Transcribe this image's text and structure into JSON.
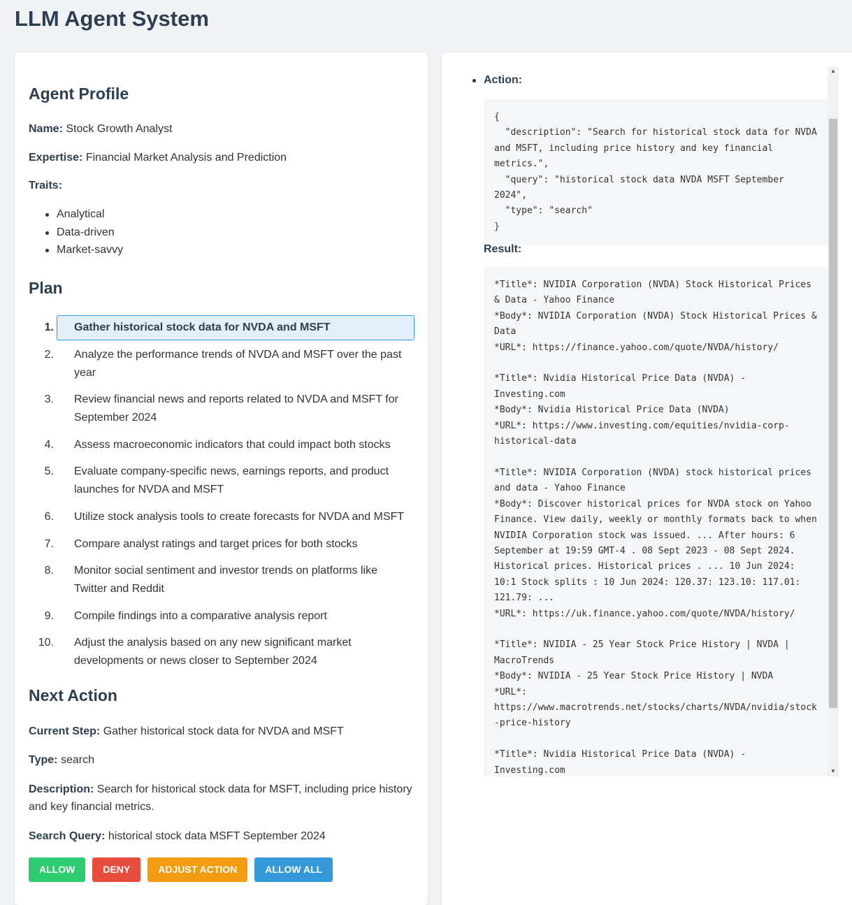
{
  "app": {
    "title": "LLM Agent System"
  },
  "profile": {
    "heading": "Agent Profile",
    "name_label": "Name:",
    "name": "Stock Growth Analyst",
    "expertise_label": "Expertise:",
    "expertise": "Financial Market Analysis and Prediction",
    "traits_label": "Traits:",
    "traits": [
      "Analytical",
      "Data-driven",
      "Market-savvy"
    ]
  },
  "plan": {
    "heading": "Plan",
    "active_index": 0,
    "steps": [
      "Gather historical stock data for NVDA and MSFT",
      "Analyze the performance trends of NVDA and MSFT over the past year",
      "Review financial news and reports related to NVDA and MSFT for September 2024",
      "Assess macroeconomic indicators that could impact both stocks",
      "Evaluate company-specific news, earnings reports, and product launches for NVDA and MSFT",
      "Utilize stock analysis tools to create forecasts for NVDA and MSFT",
      "Compare analyst ratings and target prices for both stocks",
      "Monitor social sentiment and investor trends on platforms like Twitter and Reddit",
      "Compile findings into a comparative analysis report",
      "Adjust the analysis based on any new significant market developments or news closer to September 2024"
    ]
  },
  "next_action": {
    "heading": "Next Action",
    "current_step_label": "Current Step:",
    "current_step": "Gather historical stock data for NVDA and MSFT",
    "type_label": "Type:",
    "type": "search",
    "description_label": "Description:",
    "description": "Search for historical stock data for MSFT, including price history and key financial metrics.",
    "query_label": "Search Query:",
    "query": "historical stock data MSFT September 2024"
  },
  "buttons": {
    "allow": "ALLOW",
    "deny": "DENY",
    "adjust": "ADJUST ACTION",
    "allow_all": "ALLOW ALL"
  },
  "history": {
    "action_label": "Action:",
    "action_code": "{\n  \"description\": \"Search for historical stock data for NVDA and MSFT, including price history and key financial metrics.\",\n  \"query\": \"historical stock data NVDA MSFT September 2024\",\n  \"type\": \"search\"\n}",
    "result_label": "Result:",
    "result_text": "*Title*: NVIDIA Corporation (NVDA) Stock Historical Prices & Data - Yahoo Finance\n*Body*: NVIDIA Corporation (NVDA) Stock Historical Prices & Data\n*URL*: https://finance.yahoo.com/quote/NVDA/history/\n\n*Title*: Nvidia Historical Price Data (NVDA) - Investing.com\n*Body*: Nvidia Historical Price Data (NVDA)\n*URL*: https://www.investing.com/equities/nvidia-corp-historical-data\n\n*Title*: NVIDIA Corporation (NVDA) stock historical prices and data - Yahoo Finance\n*Body*: Discover historical prices for NVDA stock on Yahoo Finance. View daily, weekly or monthly formats back to when NVIDIA Corporation stock was issued. ... After hours: 6 September at 19:59 GMT-4 . 08 Sept 2023 - 08 Sept 2024. Historical prices. Historical prices . ... 10 Jun 2024: 10:1 Stock splits : 10 Jun 2024: 120.37: 123.10: 117.01: 121.79: ...\n*URL*: https://uk.finance.yahoo.com/quote/NVDA/history/\n\n*Title*: NVIDIA - 25 Year Stock Price History | NVDA | MacroTrends\n*Body*: NVIDIA - 25 Year Stock Price History | NVDA\n*URL*: https://www.macrotrends.net/stocks/charts/NVDA/nvidia/stock-price-history\n\n*Title*: Nvidia Historical Price Data (NVDA) - Investing.com\n*Body*: Get free historical data for NVDA. You'll find the closing price, open, high, low, change and %change of the"
  },
  "colors": {
    "background": "#f0f2f5",
    "heading": "#2c3e50",
    "allow": "#2ecc71",
    "deny": "#e74c3c",
    "adjust": "#f39c12",
    "allow_all": "#3498db",
    "active_step_bg": "#e3f0fc",
    "active_step_border": "#3498db"
  },
  "icons": {
    "scroll_up": "▲",
    "scroll_down": "▼"
  }
}
